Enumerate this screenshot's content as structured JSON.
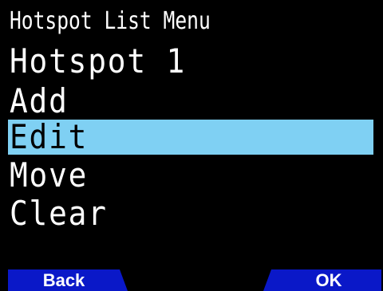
{
  "screen": {
    "header": "Hotspot List Menu",
    "title": "Hotspot 1"
  },
  "menu": {
    "items": [
      {
        "label": "Add",
        "selected": false
      },
      {
        "label": "Edit",
        "selected": true
      },
      {
        "label": "Move",
        "selected": false
      },
      {
        "label": "Clear",
        "selected": false
      }
    ]
  },
  "softkeys": {
    "left": "Back",
    "right": "OK"
  },
  "colors": {
    "background": "#000000",
    "text": "#ffffff",
    "selection": "#7fd0f3",
    "softkey": "#0a18c8"
  }
}
